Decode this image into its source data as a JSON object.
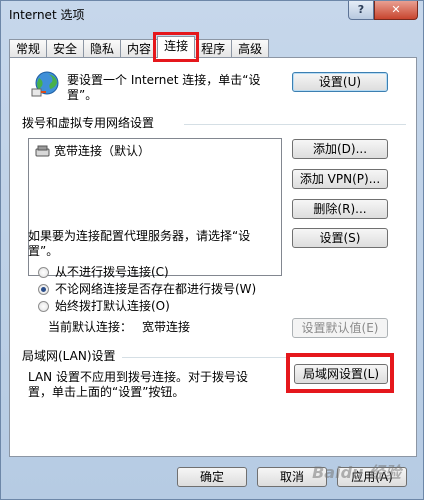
{
  "window": {
    "title": "Internet 选项",
    "help_label": "?",
    "close_label": "✕"
  },
  "tabs": [
    {
      "label": "常规"
    },
    {
      "label": "安全"
    },
    {
      "label": "隐私"
    },
    {
      "label": "内容"
    },
    {
      "label": "连接",
      "active": true
    },
    {
      "label": "程序"
    },
    {
      "label": "高级"
    }
  ],
  "setup": {
    "text_line1": "要设置一个 Internet 连接，单击“设",
    "text_line2": "置”。",
    "button": "设置(U)",
    "icon": "globe-network-icon"
  },
  "dialup": {
    "group_title": "拨号和虚拟专用网络设置",
    "connections": [
      {
        "label": "宽带连接（默认）",
        "icon": "dialup-connection-icon"
      }
    ],
    "add_button": "添加(D)...",
    "add_vpn_button": "添加 VPN(P)...",
    "delete_button": "删除(R)...",
    "settings_button": "设置(S)",
    "proxy_text_line1": "如果要为连接配置代理服务器，请选择“设",
    "proxy_text_line2": "置”。",
    "radio_options": [
      {
        "label": "从不进行拨号连接(C)",
        "checked": false
      },
      {
        "label": "不论网络连接是否存在都进行拨号(W)",
        "checked": true
      },
      {
        "label": "始终拨打默认连接(O)",
        "checked": false
      }
    ],
    "current_default_label": "当前默认连接：",
    "current_default_value": "宽带连接",
    "set_default_button": "设置默认值(E)"
  },
  "lan": {
    "group_title": "局域网(LAN)设置",
    "text_line1": "LAN 设置不应用到拨号连接。对于拨号设",
    "text_line2": "置，单击上面的“设置”按钮。",
    "button": "局域网设置(L)"
  },
  "footer": {
    "ok_button": "确定",
    "cancel_button": "取消",
    "apply_button": "应用(A)"
  },
  "watermark": "Baidu 经验",
  "colors": {
    "highlight": "#e5171c",
    "title_bar": "#c6d7eb"
  }
}
